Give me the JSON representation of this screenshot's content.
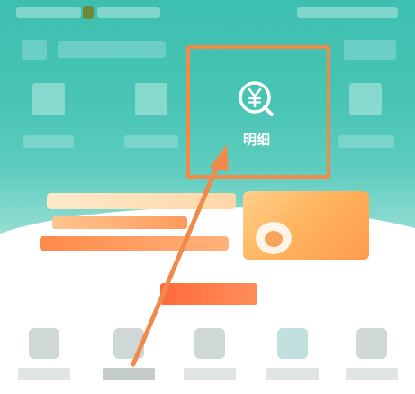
{
  "screen": {
    "highlighted_item": {
      "label": "明细",
      "icon": "yen-magnifier-icon"
    }
  },
  "colors": {
    "header_teal": "#48c4b4",
    "highlight_orange": "#f08a4b",
    "arrow_orange": "#f08a4b",
    "banner_orange": "#ffb25c",
    "icon_white": "#ffffff"
  }
}
